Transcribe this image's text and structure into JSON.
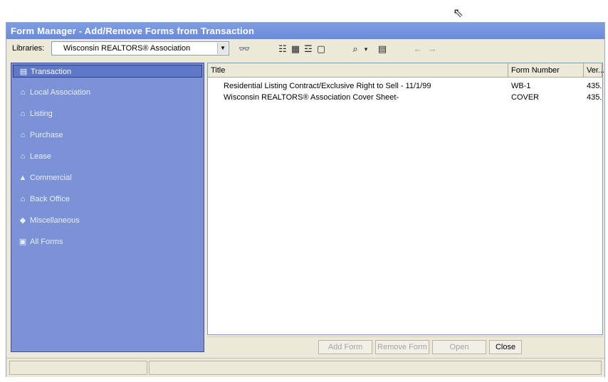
{
  "window": {
    "title": "Form Manager - Add/Remove Forms from Transaction"
  },
  "toolbar": {
    "libraries_label": "Libraries:",
    "selected_library": "Wisconsin REALTORS® Association",
    "icons": [
      "binoculars-icon",
      "list-view-icon",
      "details-view-icon",
      "thumbnail-view-icon",
      "preview-icon",
      "zoom-icon",
      "print-icon",
      "back-arrow-icon",
      "forward-arrow-icon"
    ]
  },
  "sidebar": {
    "items": [
      {
        "label": "Transaction",
        "icon": "transaction-icon",
        "active": true
      },
      {
        "label": "Local Association",
        "icon": "local-association-icon"
      },
      {
        "label": "Listing",
        "icon": "listing-icon"
      },
      {
        "label": "Purchase",
        "icon": "purchase-icon"
      },
      {
        "label": "Lease",
        "icon": "lease-icon"
      },
      {
        "label": "Commercial",
        "icon": "commercial-icon"
      },
      {
        "label": "Back Office",
        "icon": "back-office-icon"
      },
      {
        "label": "Miscellaneous",
        "icon": "miscellaneous-icon"
      },
      {
        "label": "All Forms",
        "icon": "all-forms-icon"
      }
    ]
  },
  "table": {
    "columns": [
      "Title",
      "Form Number",
      "Ver..."
    ],
    "rows": [
      {
        "title": "Residential Listing Contract/Exclusive Right to Sell - 11/1/99",
        "form_number": "WB-1",
        "version": "435..."
      },
      {
        "title": "Wisconsin REALTORS® Association Cover Sheet-",
        "form_number": "COVER",
        "version": "435..."
      }
    ]
  },
  "buttons": {
    "add_form": "Add Form",
    "remove_form": "Remove Form",
    "open": "Open",
    "close": "Close"
  },
  "colors": {
    "title_bar": "#7f9de2",
    "sidebar": "#7c92d7",
    "sidebar_active": "#5f78c8"
  }
}
